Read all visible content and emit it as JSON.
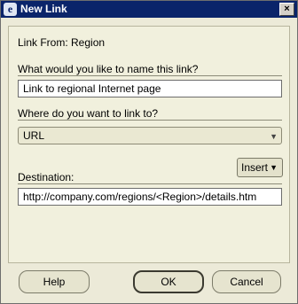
{
  "window": {
    "title": "New Link",
    "icon": "oracle-e-icon",
    "close_symbol": "×"
  },
  "form": {
    "link_from": "Link From: Region",
    "name_prompt": "What would you like to name this link?",
    "name_value": "Link to regional Internet page",
    "target_prompt": "Where do you want to link to?",
    "target_selected": "URL",
    "destination_label": "Destination:",
    "insert_label": "Insert",
    "destination_value": "http://company.com/regions/<Region>/details.htm"
  },
  "buttons": {
    "help": "Help",
    "ok": "OK",
    "cancel": "Cancel"
  }
}
